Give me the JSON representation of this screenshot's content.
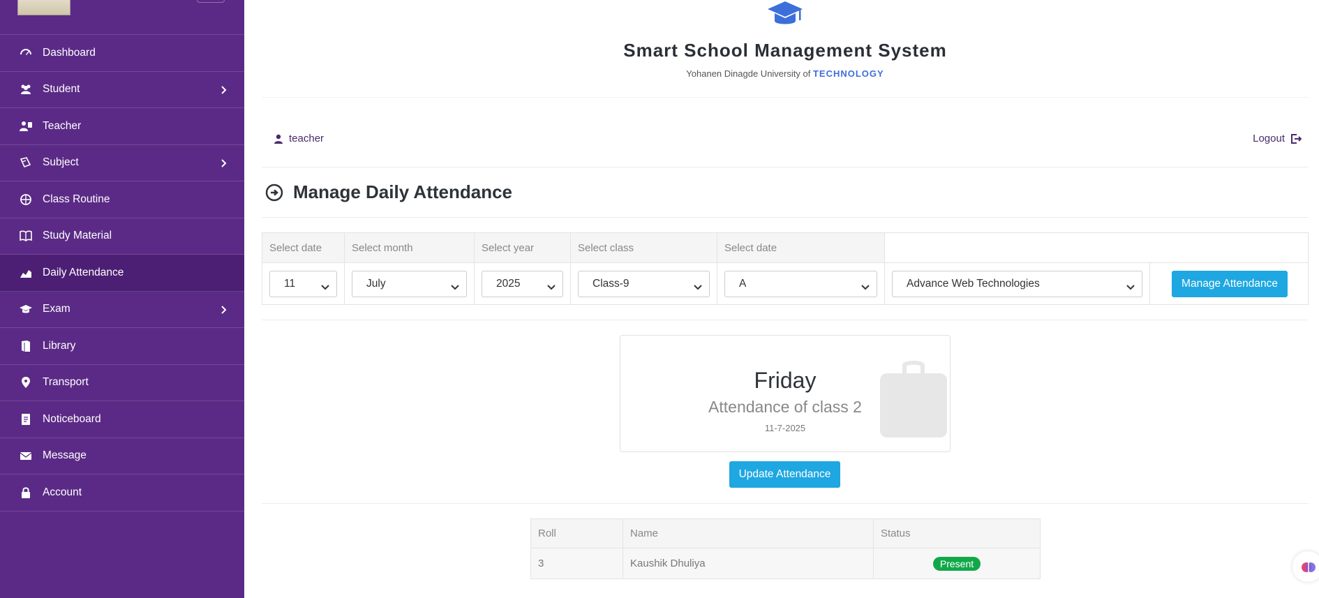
{
  "sidebar": {
    "logo_text": "Yohanen Dinagde University of Technology",
    "items": [
      {
        "label": "Dashboard",
        "icon": "dashboard-icon",
        "has_submenu": false
      },
      {
        "label": "Student",
        "icon": "users-icon",
        "has_submenu": true
      },
      {
        "label": "Teacher",
        "icon": "teacher-icon",
        "has_submenu": false
      },
      {
        "label": "Subject",
        "icon": "subject-icon",
        "has_submenu": true
      },
      {
        "label": "Class Routine",
        "icon": "routine-icon",
        "has_submenu": false
      },
      {
        "label": "Study Material",
        "icon": "book-icon",
        "has_submenu": false
      },
      {
        "label": "Daily Attendance",
        "icon": "chart-area-icon",
        "has_submenu": false,
        "active": true
      },
      {
        "label": "Exam",
        "icon": "graduation-cap-icon",
        "has_submenu": true
      },
      {
        "label": "Library",
        "icon": "library-icon",
        "has_submenu": false
      },
      {
        "label": "Transport",
        "icon": "map-pin-icon",
        "has_submenu": false
      },
      {
        "label": "Noticeboard",
        "icon": "noticeboard-icon",
        "has_submenu": false
      },
      {
        "label": "Message",
        "icon": "envelope-icon",
        "has_submenu": false
      },
      {
        "label": "Account",
        "icon": "lock-icon",
        "has_submenu": false
      }
    ]
  },
  "header": {
    "title": "Smart School Management System",
    "subtitle_prefix": "Yohanen Dinagde University of",
    "subtitle_highlight": "TECHNOLOGY"
  },
  "userbar": {
    "username": "teacher",
    "logout_label": "Logout"
  },
  "page": {
    "title": "Manage Daily Attendance"
  },
  "filters": {
    "headers": [
      "Select date",
      "Select month",
      "Select year",
      "Select class",
      "Select date",
      ""
    ],
    "date": "11",
    "month": "July",
    "year": "2025",
    "class": "Class-9",
    "section": "A",
    "subject": "Advance Web Technologies",
    "manage_button": "Manage Attendance"
  },
  "summary": {
    "day": "Friday",
    "class_text": "Attendance of class 2",
    "date": "11-7-2025",
    "update_button": "Update Attendance"
  },
  "students": {
    "headers": [
      "Roll",
      "Name",
      "Status"
    ],
    "rows": [
      {
        "roll": "3",
        "name": "Kaushik Dhuliya",
        "status": "Present"
      }
    ]
  },
  "colors": {
    "sidebar_bg": "#5b2a86",
    "accent_blue": "#1ea7e1",
    "brand_blue": "#3d6fdb",
    "present_green": "#12a84a"
  }
}
